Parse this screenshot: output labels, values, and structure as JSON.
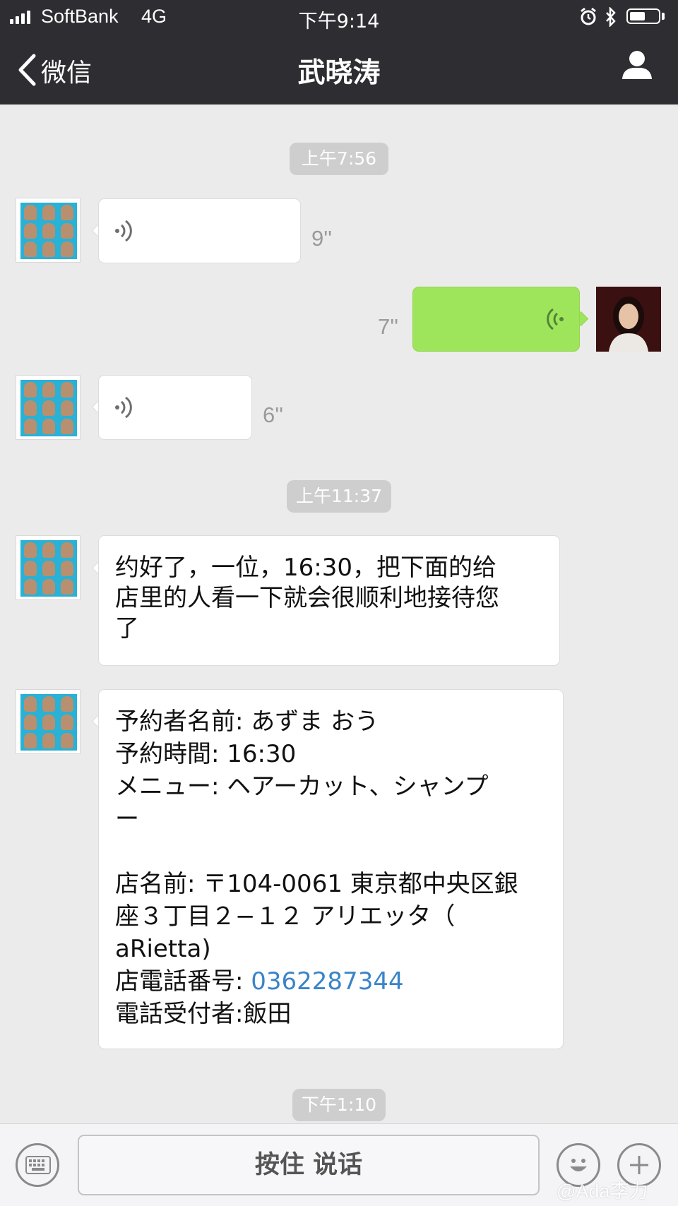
{
  "status_bar": {
    "carrier": "SoftBank",
    "network": "4G",
    "time": "下午9:14",
    "battery_level": 0.55
  },
  "nav": {
    "back_label": "微信",
    "title": "武晓涛"
  },
  "messages": [
    {
      "type": "time",
      "text": "上午7:56"
    },
    {
      "type": "voice",
      "side": "left",
      "duration": "9''"
    },
    {
      "type": "voice",
      "side": "right",
      "duration": "7''"
    },
    {
      "type": "voice",
      "side": "left",
      "duration": "6''"
    },
    {
      "type": "time",
      "text": "上午11:37"
    },
    {
      "type": "text",
      "side": "left",
      "lines": [
        "约好了，一位，16:30，把下面的给",
        "店里的人看一下就会很顺利地接待您",
        "了"
      ]
    },
    {
      "type": "text",
      "side": "left",
      "lines": [
        "予約者名前: あずま おう",
        "予約時間: 16:30",
        "メニュー: ヘアーカット、シャンプ",
        "ー",
        "",
        "店名前: 〒104-0061 東京都中央区銀",
        "座３丁目２−１２ アリエッタ（",
        "aRietta)"
      ],
      "phone_label": "店電話番号: ",
      "phone_number": "0362287344",
      "last_line": "電話受付者:飯田"
    },
    {
      "type": "time",
      "text": "下午1:10"
    }
  ],
  "input_bar": {
    "hold_to_talk_label": "按住 说话"
  },
  "watermark": "@Ada李力",
  "colors": {
    "header_bg": "#2e2e32",
    "chat_bg": "#ebebeb",
    "self_bubble": "#9fe55b",
    "link": "#3a84c8"
  }
}
